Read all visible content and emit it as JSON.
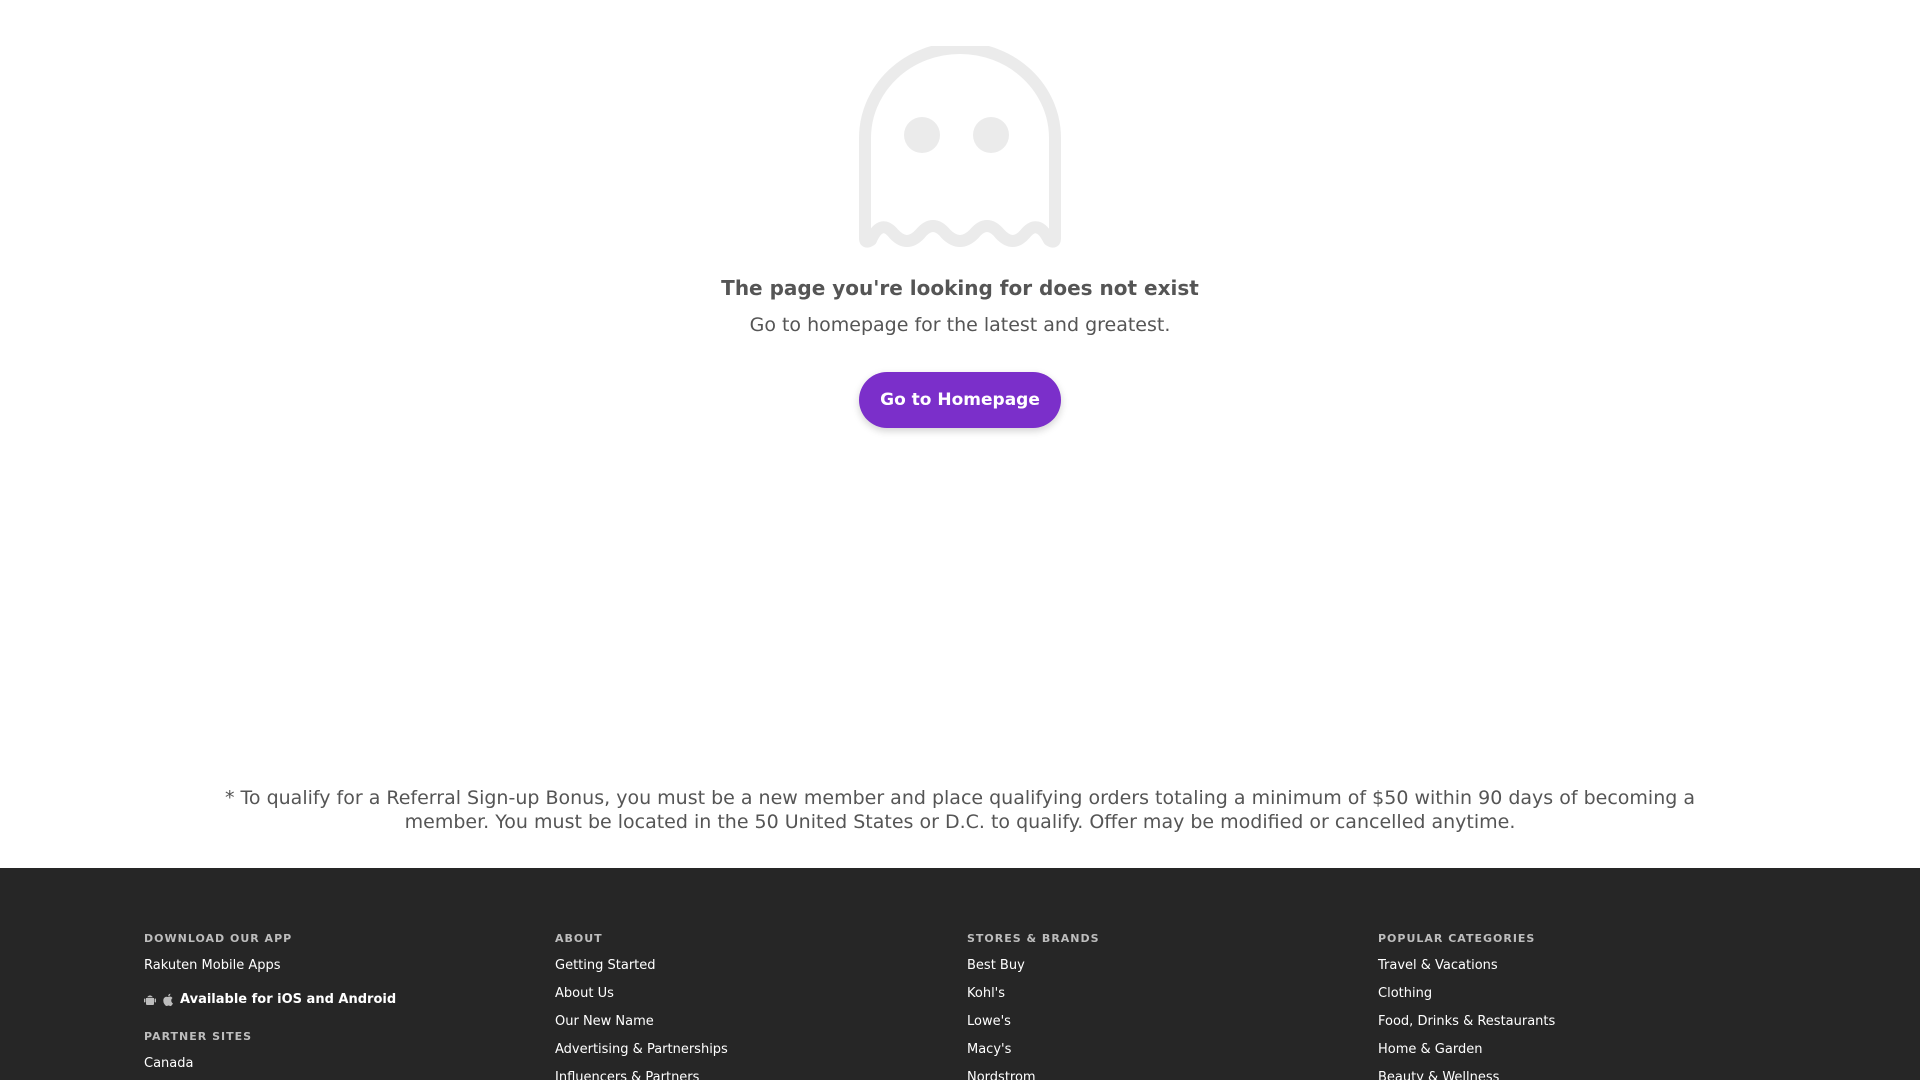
{
  "error": {
    "icon": "ghost-icon",
    "title": "The page you're looking for does not exist",
    "subtitle": "Go to homepage for the latest and greatest.",
    "button_label": "Go to Homepage"
  },
  "disclaimer": "* To qualify for a Referral Sign-up Bonus, you must be a new member and place qualifying orders totaling a minimum of $50 within 90 days of becoming a member. You must be located in the 50 United States or D.C. to qualify. Offer may be modified or cancelled anytime.",
  "colors": {
    "accent": "#7b2fca",
    "footer_bg": "#262626",
    "ghost": "#ebebeb"
  },
  "footer": {
    "download": {
      "title": "DOWNLOAD OUR APP",
      "link": "Rakuten Mobile Apps",
      "platforms_text": "Available for iOS and Android",
      "icons": [
        "android-icon",
        "apple-icon"
      ]
    },
    "partner": {
      "title": "PARTNER SITES",
      "items": [
        "Canada"
      ]
    },
    "about": {
      "title": "ABOUT",
      "items": [
        "Getting Started",
        "About Us",
        "Our New Name",
        "Advertising & Partnerships",
        "Influencers & Partners"
      ]
    },
    "stores": {
      "title": "STORES & BRANDS",
      "items": [
        "Best Buy",
        "Kohl's",
        "Lowe's",
        "Macy's",
        "Nordstrom"
      ]
    },
    "categories": {
      "title": "POPULAR CATEGORIES",
      "items": [
        "Travel & Vacations",
        "Clothing",
        "Food, Drinks & Restaurants",
        "Home & Garden",
        "Beauty & Wellness"
      ]
    }
  }
}
